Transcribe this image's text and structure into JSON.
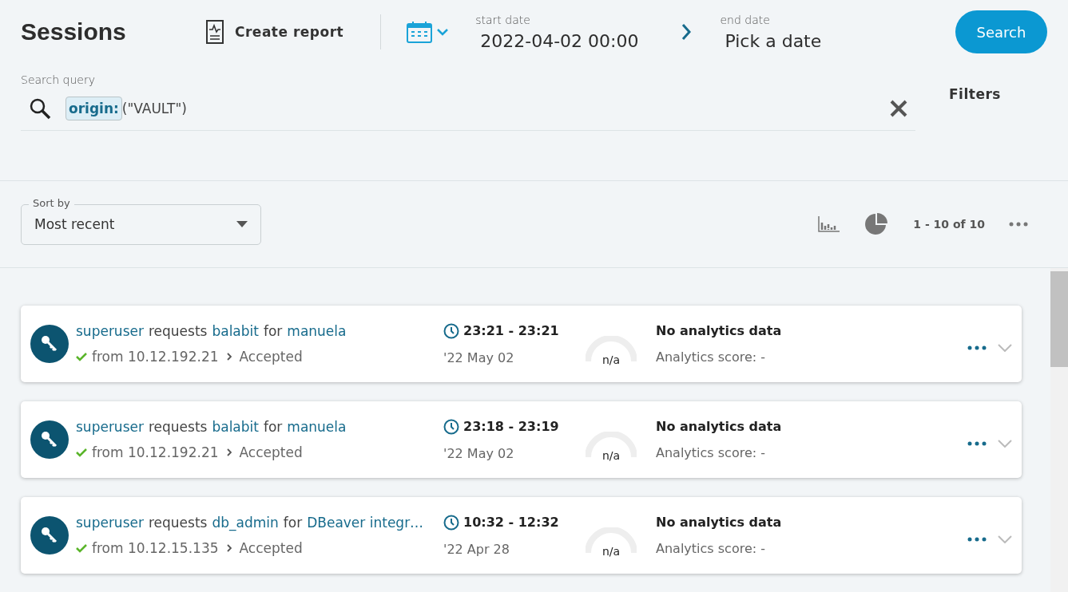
{
  "title": "Sessions",
  "create_report": "Create report",
  "start_date": {
    "label": "start date",
    "value": "2022-04-02 00:00"
  },
  "end_date": {
    "label": "end date",
    "value": "Pick a date"
  },
  "search_button": "Search",
  "query": {
    "label": "Search query",
    "key": "origin:",
    "value": "(\"VAULT\")"
  },
  "filters": "Filters",
  "sort": {
    "label": "Sort by",
    "value": "Most recent"
  },
  "pagination": "1 - 10 of 10",
  "sessions": [
    {
      "user": "superuser",
      "verb": "requests",
      "target": "balabit",
      "prep": "for",
      "subject": "manuela",
      "from": "from 10.12.192.21",
      "status": "Accepted",
      "time": "23:21 - 23:21",
      "date": "'22 May 02",
      "gauge": "n/a",
      "analytics": "No analytics data",
      "score": "Analytics score: -"
    },
    {
      "user": "superuser",
      "verb": "requests",
      "target": "balabit",
      "prep": "for",
      "subject": "manuela",
      "from": "from 10.12.192.21",
      "status": "Accepted",
      "time": "23:18 - 23:19",
      "date": "'22 May 02",
      "gauge": "n/a",
      "analytics": "No analytics data",
      "score": "Analytics score: -"
    },
    {
      "user": "superuser",
      "verb": "requests",
      "target": "db_admin",
      "prep": "for",
      "subject": "DBeaver integr…",
      "from": "from 10.12.15.135",
      "status": "Accepted",
      "time": "10:32 - 12:32",
      "date": "'22 Apr 28",
      "gauge": "n/a",
      "analytics": "No analytics data",
      "score": "Analytics score: -"
    }
  ]
}
